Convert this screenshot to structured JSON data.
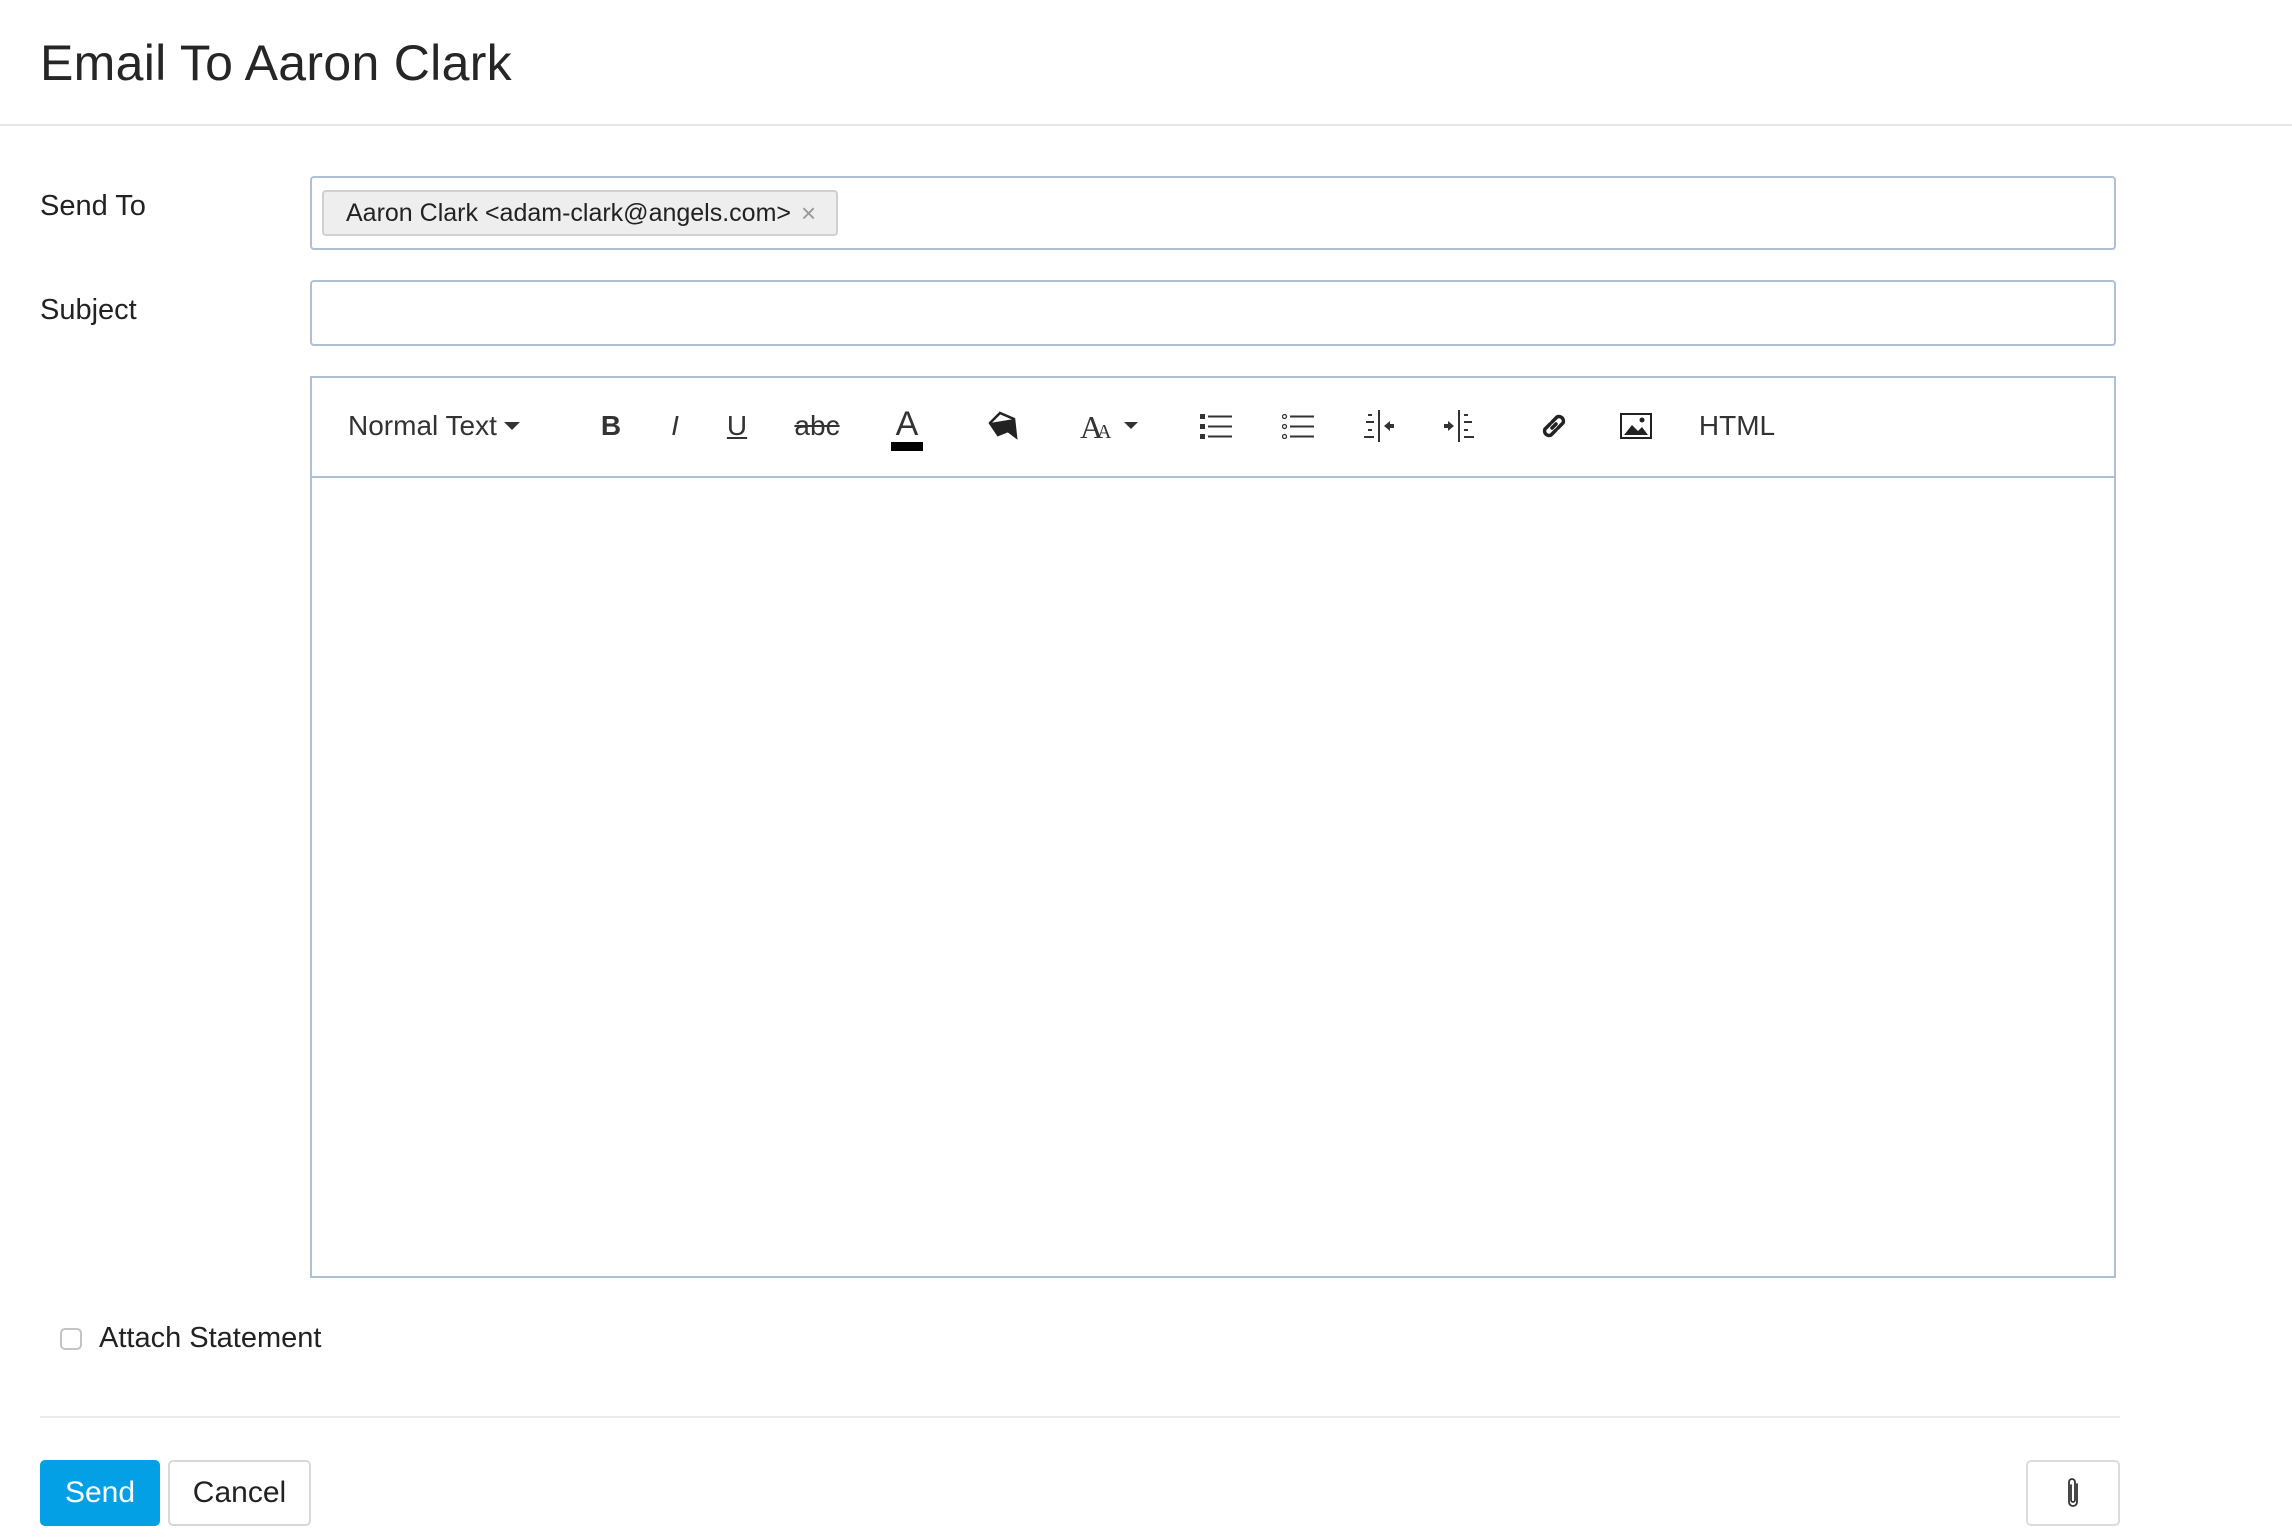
{
  "dialog": {
    "title": "Email To Aaron Clark"
  },
  "form": {
    "send_to": {
      "label": "Send To",
      "recipients": [
        {
          "text": "Aaron Clark <adam-clark@angels.com>",
          "remove_icon": "×"
        }
      ]
    },
    "subject": {
      "label": "Subject",
      "value": "",
      "placeholder": ""
    }
  },
  "editor": {
    "toolbar": {
      "format_select": "Normal Text",
      "bold": "B",
      "italic": "I",
      "underline": "U",
      "strikethrough": "abc",
      "font_color": "A",
      "html": "HTML",
      "icons": [
        "font-color-icon",
        "background-color-icon",
        "font-size-icon",
        "ordered-list-icon",
        "unordered-list-icon",
        "outdent-icon",
        "indent-icon",
        "link-icon",
        "image-icon"
      ]
    },
    "body": ""
  },
  "attach_statement": {
    "label": "Attach Statement",
    "checked": false
  },
  "actions": {
    "send": "Send",
    "cancel": "Cancel",
    "attach_icon": "paperclip-icon"
  },
  "colors": {
    "primary": "#03a0e6",
    "input_border": "#aebfd6"
  }
}
